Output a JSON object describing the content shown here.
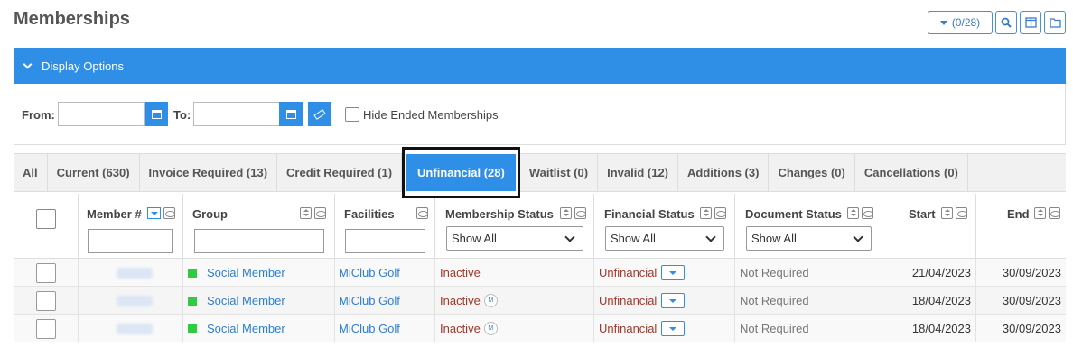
{
  "page": {
    "title": "Memberships"
  },
  "toolbar": {
    "count_label": "(0/28)"
  },
  "display_options": {
    "label": "Display Options"
  },
  "filters": {
    "from_label": "From:",
    "to_label": "To:",
    "from_value": "",
    "to_value": "",
    "hide_ended_label": "Hide Ended Memberships"
  },
  "tabs": [
    {
      "label": "All"
    },
    {
      "label": "Current (630)"
    },
    {
      "label": "Invoice Required (13)"
    },
    {
      "label": "Credit Required (1)"
    },
    {
      "label": "Unfinancial (28)",
      "active": true
    },
    {
      "label": "Waitlist (0)"
    },
    {
      "label": "Invalid (12)"
    },
    {
      "label": "Additions (3)"
    },
    {
      "label": "Changes (0)"
    },
    {
      "label": "Cancellations (0)"
    }
  ],
  "columns": {
    "member": "Member #",
    "group": "Group",
    "facilities": "Facilities",
    "membership_status": "Membership Status",
    "financial_status": "Financial Status",
    "document_status": "Document Status",
    "start": "Start",
    "end": "End"
  },
  "selects": {
    "membership_status": "Show All",
    "financial_status": "Show All",
    "document_status": "Show All"
  },
  "rows": [
    {
      "group": "Social Member",
      "facilities": "MiClub Golf",
      "membership_status": "Inactive",
      "badge": "",
      "financial_status": "Unfinancial",
      "document_status": "Not Required",
      "start": "21/04/2023",
      "end": "30/09/2023"
    },
    {
      "group": "Social Member",
      "facilities": "MiClub Golf",
      "membership_status": "Inactive",
      "badge": "M",
      "financial_status": "Unfinancial",
      "document_status": "Not Required",
      "start": "18/04/2023",
      "end": "30/09/2023"
    },
    {
      "group": "Social Member",
      "facilities": "MiClub Golf",
      "membership_status": "Inactive",
      "badge": "M",
      "financial_status": "Unfinancial",
      "document_status": "Not Required",
      "start": "18/04/2023",
      "end": "30/09/2023"
    }
  ],
  "colors": {
    "accent": "#2f8ee5",
    "status_red": "#a0392b",
    "group_green": "#2ecc40"
  }
}
